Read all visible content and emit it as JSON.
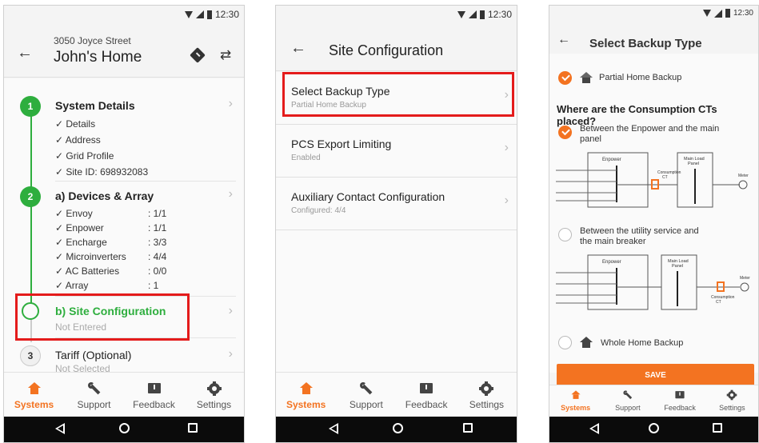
{
  "status": {
    "time": "12:30"
  },
  "tabs": [
    "Systems",
    "Support",
    "Feedback",
    "Settings"
  ],
  "screen1": {
    "address": "3050 Joyce Street",
    "home_name": "John's Home",
    "steps": [
      {
        "num": "1",
        "title": "System Details"
      },
      {
        "num": "2",
        "title": "a) Devices & Array"
      },
      {
        "title": "b) Site Configuration",
        "sub": "Not Entered"
      },
      {
        "num": "3",
        "title": "Tariff (Optional)",
        "sub": "Not Selected"
      }
    ],
    "system_details": [
      "✓ Details",
      "✓ Address",
      "✓ Grid Profile",
      "✓ Site ID: 698932083"
    ],
    "devices": [
      {
        "name": "✓ Envoy",
        "value": ": 1/1"
      },
      {
        "name": "✓ Enpower",
        "value": ": 1/1"
      },
      {
        "name": "✓ Encharge",
        "value": ": 3/3"
      },
      {
        "name": "✓ Microinverters",
        "value": ": 4/4"
      },
      {
        "name": "✓ AC Batteries",
        "value": ": 0/0"
      },
      {
        "name": "✓ Array",
        "value": ": 1"
      }
    ]
  },
  "screen2": {
    "title": "Site Configuration",
    "rows": [
      {
        "title": "Select Backup Type",
        "sub": "Partial Home Backup"
      },
      {
        "title": "PCS Export Limiting",
        "sub": "Enabled"
      },
      {
        "title": "Auxiliary Contact Configuration",
        "sub": "Configured: 4/4"
      }
    ]
  },
  "screen3": {
    "title": "Select Backup Type",
    "partial_label": "Partial Home Backup",
    "question": "Where are the Consumption CTs placed?",
    "option1": [
      "Between the Enpower and the main",
      "panel"
    ],
    "option2": [
      "Between the utility service and",
      "the main breaker"
    ],
    "whole_label": "Whole Home Backup",
    "save_label": "SAVE",
    "diagram": {
      "enpower": "Enpower",
      "main_load_panel": [
        "Main Load",
        "Panel"
      ],
      "consumption_ct": [
        "Consumption",
        "CT"
      ],
      "meter": "Meter"
    }
  }
}
